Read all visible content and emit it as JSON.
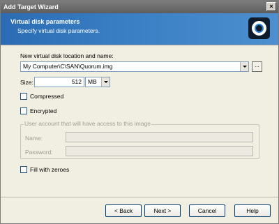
{
  "window": {
    "title": "Add Target Wizard"
  },
  "banner": {
    "title": "Virtual disk parameters",
    "subtitle": "Specify virtual disk parameters."
  },
  "location": {
    "label": "New virtual disk location and name:",
    "value": "My Computer\\C\\SAN\\Quorum.img",
    "browse_label": "..."
  },
  "size": {
    "label": "Size:",
    "value": "512",
    "unit": "MB"
  },
  "options": {
    "compressed": {
      "label": "Compressed",
      "checked": false
    },
    "encrypted": {
      "label": "Encrypted",
      "checked": false
    },
    "fill_zeroes": {
      "label": "Fill with zeroes",
      "checked": false
    }
  },
  "account": {
    "group_title": "User account that will have access to this image",
    "name_label": "Name:",
    "name_value": "",
    "password_label": "Password:",
    "password_value": ""
  },
  "buttons": {
    "back": "< Back",
    "next": "Next >",
    "cancel": "Cancel",
    "help": "Help"
  }
}
